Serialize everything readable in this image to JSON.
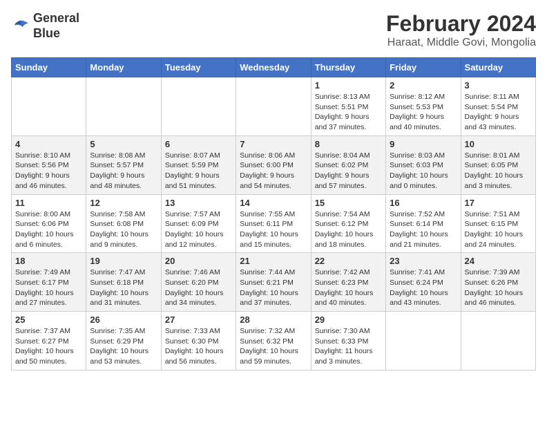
{
  "header": {
    "logo_line1": "General",
    "logo_line2": "Blue",
    "month": "February 2024",
    "location": "Haraat, Middle Govi, Mongolia"
  },
  "columns": [
    "Sunday",
    "Monday",
    "Tuesday",
    "Wednesday",
    "Thursday",
    "Friday",
    "Saturday"
  ],
  "weeks": [
    {
      "days": [
        {
          "num": "",
          "info": ""
        },
        {
          "num": "",
          "info": ""
        },
        {
          "num": "",
          "info": ""
        },
        {
          "num": "",
          "info": ""
        },
        {
          "num": "1",
          "info": "Sunrise: 8:13 AM\nSunset: 5:51 PM\nDaylight: 9 hours\nand 37 minutes."
        },
        {
          "num": "2",
          "info": "Sunrise: 8:12 AM\nSunset: 5:53 PM\nDaylight: 9 hours\nand 40 minutes."
        },
        {
          "num": "3",
          "info": "Sunrise: 8:11 AM\nSunset: 5:54 PM\nDaylight: 9 hours\nand 43 minutes."
        }
      ]
    },
    {
      "days": [
        {
          "num": "4",
          "info": "Sunrise: 8:10 AM\nSunset: 5:56 PM\nDaylight: 9 hours\nand 46 minutes."
        },
        {
          "num": "5",
          "info": "Sunrise: 8:08 AM\nSunset: 5:57 PM\nDaylight: 9 hours\nand 48 minutes."
        },
        {
          "num": "6",
          "info": "Sunrise: 8:07 AM\nSunset: 5:59 PM\nDaylight: 9 hours\nand 51 minutes."
        },
        {
          "num": "7",
          "info": "Sunrise: 8:06 AM\nSunset: 6:00 PM\nDaylight: 9 hours\nand 54 minutes."
        },
        {
          "num": "8",
          "info": "Sunrise: 8:04 AM\nSunset: 6:02 PM\nDaylight: 9 hours\nand 57 minutes."
        },
        {
          "num": "9",
          "info": "Sunrise: 8:03 AM\nSunset: 6:03 PM\nDaylight: 10 hours\nand 0 minutes."
        },
        {
          "num": "10",
          "info": "Sunrise: 8:01 AM\nSunset: 6:05 PM\nDaylight: 10 hours\nand 3 minutes."
        }
      ]
    },
    {
      "days": [
        {
          "num": "11",
          "info": "Sunrise: 8:00 AM\nSunset: 6:06 PM\nDaylight: 10 hours\nand 6 minutes."
        },
        {
          "num": "12",
          "info": "Sunrise: 7:58 AM\nSunset: 6:08 PM\nDaylight: 10 hours\nand 9 minutes."
        },
        {
          "num": "13",
          "info": "Sunrise: 7:57 AM\nSunset: 6:09 PM\nDaylight: 10 hours\nand 12 minutes."
        },
        {
          "num": "14",
          "info": "Sunrise: 7:55 AM\nSunset: 6:11 PM\nDaylight: 10 hours\nand 15 minutes."
        },
        {
          "num": "15",
          "info": "Sunrise: 7:54 AM\nSunset: 6:12 PM\nDaylight: 10 hours\nand 18 minutes."
        },
        {
          "num": "16",
          "info": "Sunrise: 7:52 AM\nSunset: 6:14 PM\nDaylight: 10 hours\nand 21 minutes."
        },
        {
          "num": "17",
          "info": "Sunrise: 7:51 AM\nSunset: 6:15 PM\nDaylight: 10 hours\nand 24 minutes."
        }
      ]
    },
    {
      "days": [
        {
          "num": "18",
          "info": "Sunrise: 7:49 AM\nSunset: 6:17 PM\nDaylight: 10 hours\nand 27 minutes."
        },
        {
          "num": "19",
          "info": "Sunrise: 7:47 AM\nSunset: 6:18 PM\nDaylight: 10 hours\nand 31 minutes."
        },
        {
          "num": "20",
          "info": "Sunrise: 7:46 AM\nSunset: 6:20 PM\nDaylight: 10 hours\nand 34 minutes."
        },
        {
          "num": "21",
          "info": "Sunrise: 7:44 AM\nSunset: 6:21 PM\nDaylight: 10 hours\nand 37 minutes."
        },
        {
          "num": "22",
          "info": "Sunrise: 7:42 AM\nSunset: 6:23 PM\nDaylight: 10 hours\nand 40 minutes."
        },
        {
          "num": "23",
          "info": "Sunrise: 7:41 AM\nSunset: 6:24 PM\nDaylight: 10 hours\nand 43 minutes."
        },
        {
          "num": "24",
          "info": "Sunrise: 7:39 AM\nSunset: 6:26 PM\nDaylight: 10 hours\nand 46 minutes."
        }
      ]
    },
    {
      "days": [
        {
          "num": "25",
          "info": "Sunrise: 7:37 AM\nSunset: 6:27 PM\nDaylight: 10 hours\nand 50 minutes."
        },
        {
          "num": "26",
          "info": "Sunrise: 7:35 AM\nSunset: 6:29 PM\nDaylight: 10 hours\nand 53 minutes."
        },
        {
          "num": "27",
          "info": "Sunrise: 7:33 AM\nSunset: 6:30 PM\nDaylight: 10 hours\nand 56 minutes."
        },
        {
          "num": "28",
          "info": "Sunrise: 7:32 AM\nSunset: 6:32 PM\nDaylight: 10 hours\nand 59 minutes."
        },
        {
          "num": "29",
          "info": "Sunrise: 7:30 AM\nSunset: 6:33 PM\nDaylight: 11 hours\nand 3 minutes."
        },
        {
          "num": "",
          "info": ""
        },
        {
          "num": "",
          "info": ""
        }
      ]
    }
  ]
}
